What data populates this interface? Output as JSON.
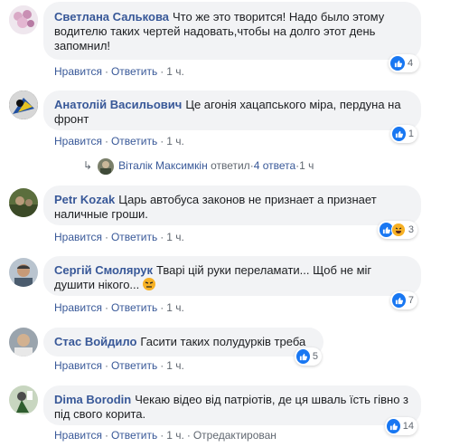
{
  "comments": [
    {
      "author": "Светлана Салькова",
      "text": "Что же это творится! Надо было этому водителю таких чертей надовать,чтобы на долго этот день запомнил!",
      "like": "Нравится",
      "reply": "Ответить",
      "time": "1 ч.",
      "reactions": "4"
    },
    {
      "author": "Анатолій Васильович",
      "text": "Це агонія хацапського міра, пердуна на фронт",
      "like": "Нравится",
      "reply": "Ответить",
      "time": "1 ч.",
      "reactions": "1"
    },
    {
      "author": "Petr Kozak",
      "text": "Царь автобуса законов не признает а признает наличные гроши.",
      "like": "Нравится",
      "reply": "Ответить",
      "time": "1 ч.",
      "reactions": "3"
    },
    {
      "author": "Сергій Смолярук",
      "text": "Тварі цій руки переламати... Щоб не міг душити нікого...",
      "like": "Нравится",
      "reply": "Ответить",
      "time": "1 ч.",
      "reactions": "7"
    },
    {
      "author": "Стас Войдило",
      "text": "Гасити таких полудурків треба",
      "like": "Нравится",
      "reply": "Ответить",
      "time": "1 ч.",
      "reactions": "5"
    },
    {
      "author": "Dima Borodin",
      "text": "Чекаю відео від патріотів, де ця шваль їсть гівно з під свого корита.",
      "like": "Нравится",
      "reply": "Ответить",
      "time": "1 ч.",
      "edited": "Отредактирован",
      "reactions": "14"
    }
  ],
  "reply_summary": {
    "author": "Віталік Максимкін",
    "action": "ответил",
    "count": "4 ответа",
    "time": "1 ч"
  },
  "sep": "·",
  "colors": {
    "link": "#385898",
    "bubble": "#f2f3f5",
    "like": "#1877f2",
    "haha": "#f7b125"
  }
}
